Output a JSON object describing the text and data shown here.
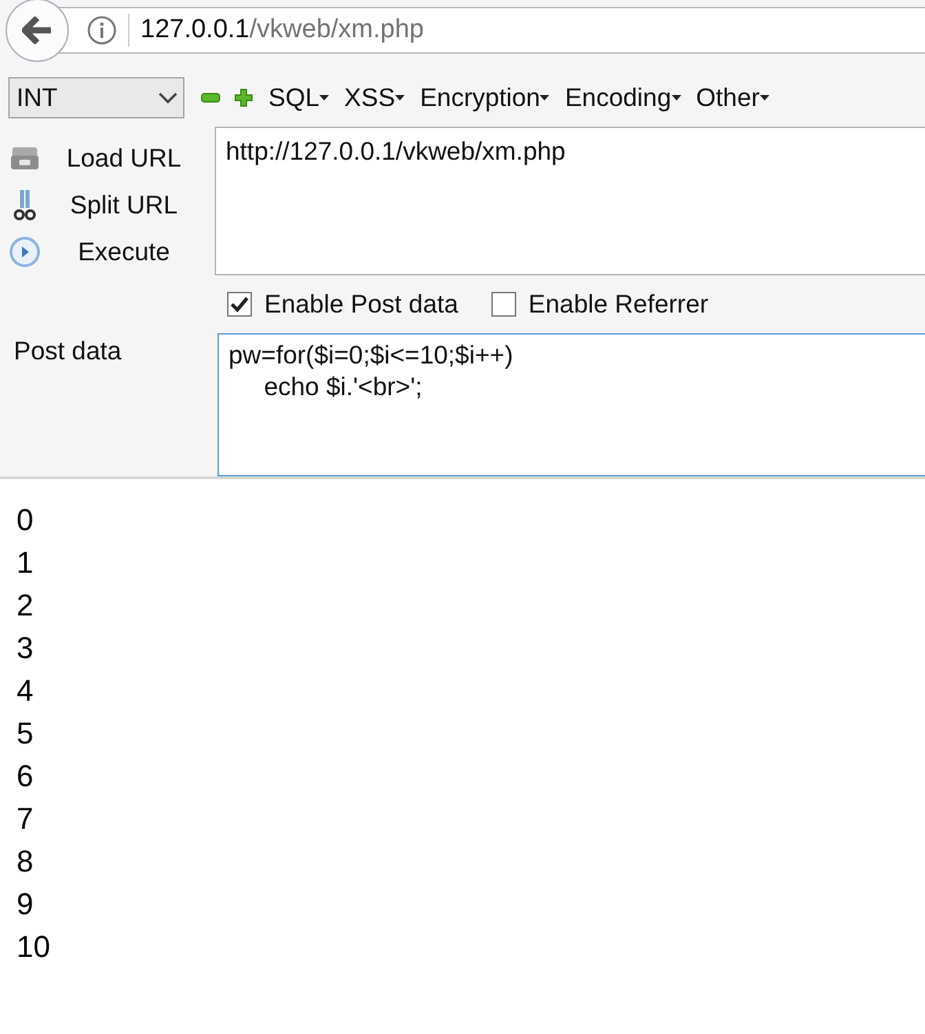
{
  "address_bar": {
    "host": "127.0.0.1",
    "path": "/vkweb/xm.php"
  },
  "toolbar": {
    "select": {
      "value": "INT"
    },
    "menus": [
      {
        "label": "SQL"
      },
      {
        "label": "XSS"
      },
      {
        "label": "Encryption"
      },
      {
        "label": "Encoding"
      },
      {
        "label": "Other"
      }
    ]
  },
  "actions": [
    {
      "kind": "load",
      "label": "Load URL"
    },
    {
      "kind": "split",
      "label": "Split URL"
    },
    {
      "kind": "execute",
      "label": "Execute"
    }
  ],
  "url_field": {
    "value": "http://127.0.0.1/vkweb/xm.php"
  },
  "options": [
    {
      "label": "Enable Post data",
      "checked": true
    },
    {
      "label": "Enable Referrer",
      "checked": false
    }
  ],
  "post_data": {
    "label": "Post data",
    "value": "pw=for($i=0;$i<=10;$i++)\n\techo $i.'<br>';"
  },
  "output": [
    "0",
    "1",
    "2",
    "3",
    "4",
    "5",
    "6",
    "7",
    "8",
    "9",
    "10"
  ]
}
